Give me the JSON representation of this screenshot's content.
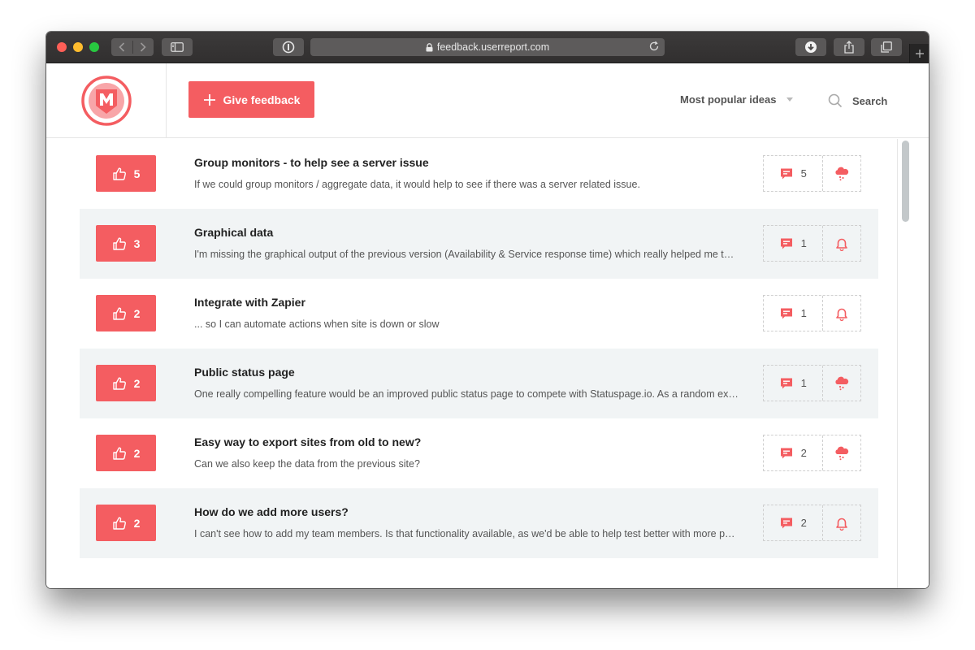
{
  "browser": {
    "url": "feedback.userreport.com"
  },
  "header": {
    "give_feedback_label": "Give feedback",
    "sort_label": "Most popular ideas",
    "search_label": "Search"
  },
  "colors": {
    "accent": "#f45d61",
    "shaded_row": "#f1f4f5"
  },
  "ideas": [
    {
      "votes": "5",
      "title": "Group monitors - to help see a server issue",
      "description": "If we could group monitors / aggregate data, it would help to see if there was a server related issue.",
      "comments": "5",
      "follow_icon": "cloud-icon"
    },
    {
      "votes": "3",
      "title": "Graphical data",
      "description": "I'm missing the graphical output of the previous version (Availability & Service response time) which really helped me to see trends over time.",
      "comments": "1",
      "follow_icon": "bell-icon"
    },
    {
      "votes": "2",
      "title": "Integrate with Zapier",
      "description": "... so I can automate actions when site is down or slow",
      "comments": "1",
      "follow_icon": "bell-icon"
    },
    {
      "votes": "2",
      "title": "Public status page",
      "description": "One really compelling feature would be an improved public status page to compete with Statuspage.io. As a random example of what I mean here.",
      "comments": "1",
      "follow_icon": "cloud-icon"
    },
    {
      "votes": "2",
      "title": "Easy way to export sites from old to new?",
      "description": "Can we also keep the data from the previous site?",
      "comments": "2",
      "follow_icon": "cloud-icon"
    },
    {
      "votes": "2",
      "title": "How do we add more users?",
      "description": "I can't see how to add my team members. Is that functionality available, as we'd be able to help test better with more people.",
      "comments": "2",
      "follow_icon": "bell-icon"
    }
  ]
}
